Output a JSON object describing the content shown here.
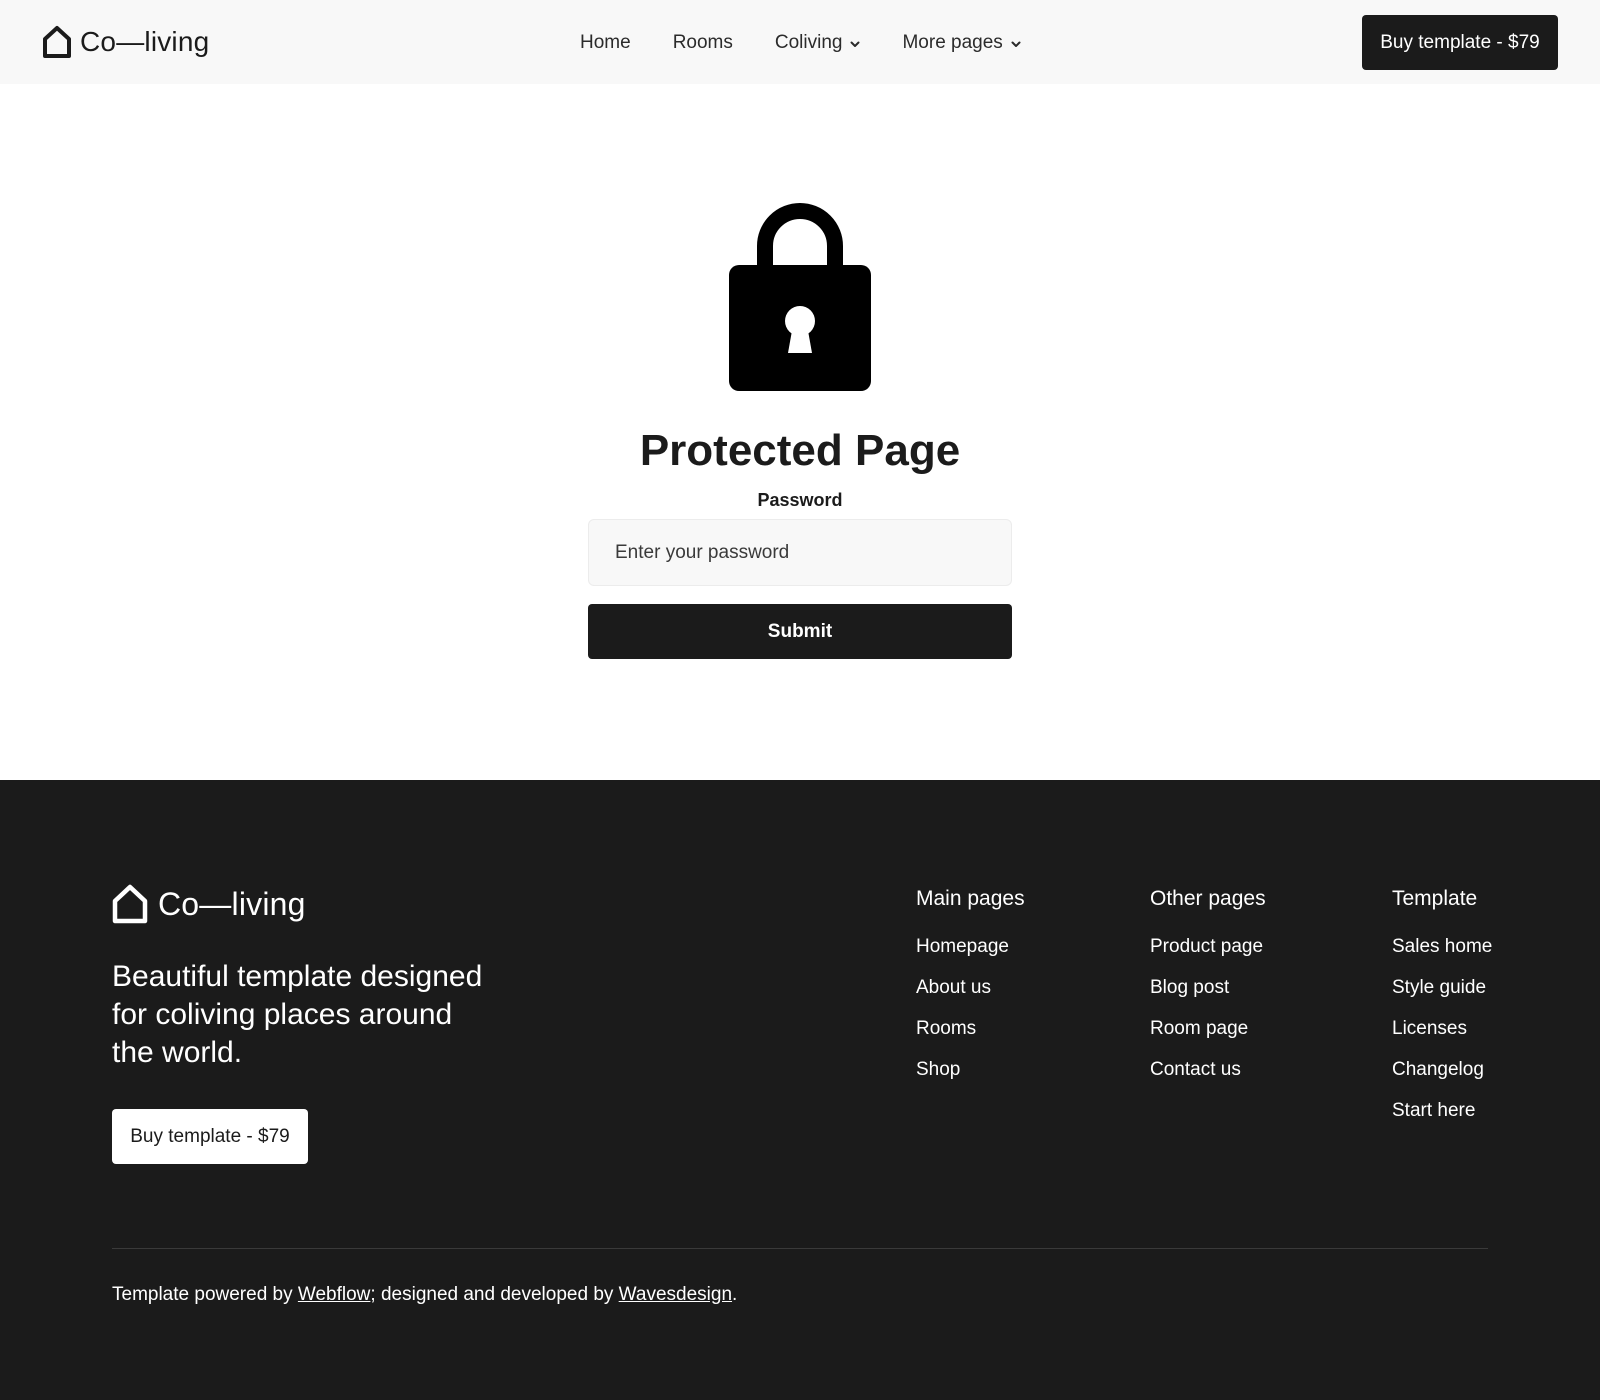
{
  "header": {
    "logo_text": "Co—living",
    "nav": [
      {
        "label": "Home",
        "has_dropdown": false
      },
      {
        "label": "Rooms",
        "has_dropdown": false
      },
      {
        "label": "Coliving",
        "has_dropdown": true
      },
      {
        "label": "More pages",
        "has_dropdown": true
      }
    ],
    "cta_label": "Buy template - $79"
  },
  "main": {
    "icon": "lock-icon",
    "title": "Protected Page",
    "password_label": "Password",
    "password_placeholder": "Enter your password",
    "password_value": "",
    "submit_label": "Submit"
  },
  "footer": {
    "logo_text": "Co—living",
    "tagline": "Beautiful template designed for coliving places around the world.",
    "cta_label": "Buy template - $79",
    "columns": [
      {
        "heading": "Main pages",
        "links": [
          "Homepage",
          "About us",
          "Rooms",
          "Shop"
        ]
      },
      {
        "heading": "Other pages",
        "links": [
          "Product page",
          "Blog post",
          "Room page",
          "Contact us"
        ]
      },
      {
        "heading": "Template",
        "links": [
          "Sales home",
          "Style guide",
          "Licenses",
          "Changelog",
          "Start here"
        ]
      }
    ],
    "credits": {
      "prefix": "Template powered by ",
      "link1": "Webflow",
      "middle": "; designed and developed by ",
      "link2": "Wavesdesign",
      "suffix": "."
    }
  },
  "colors": {
    "dark": "#1b1b1b",
    "light_bg": "#f8f8f8",
    "white": "#ffffff"
  }
}
